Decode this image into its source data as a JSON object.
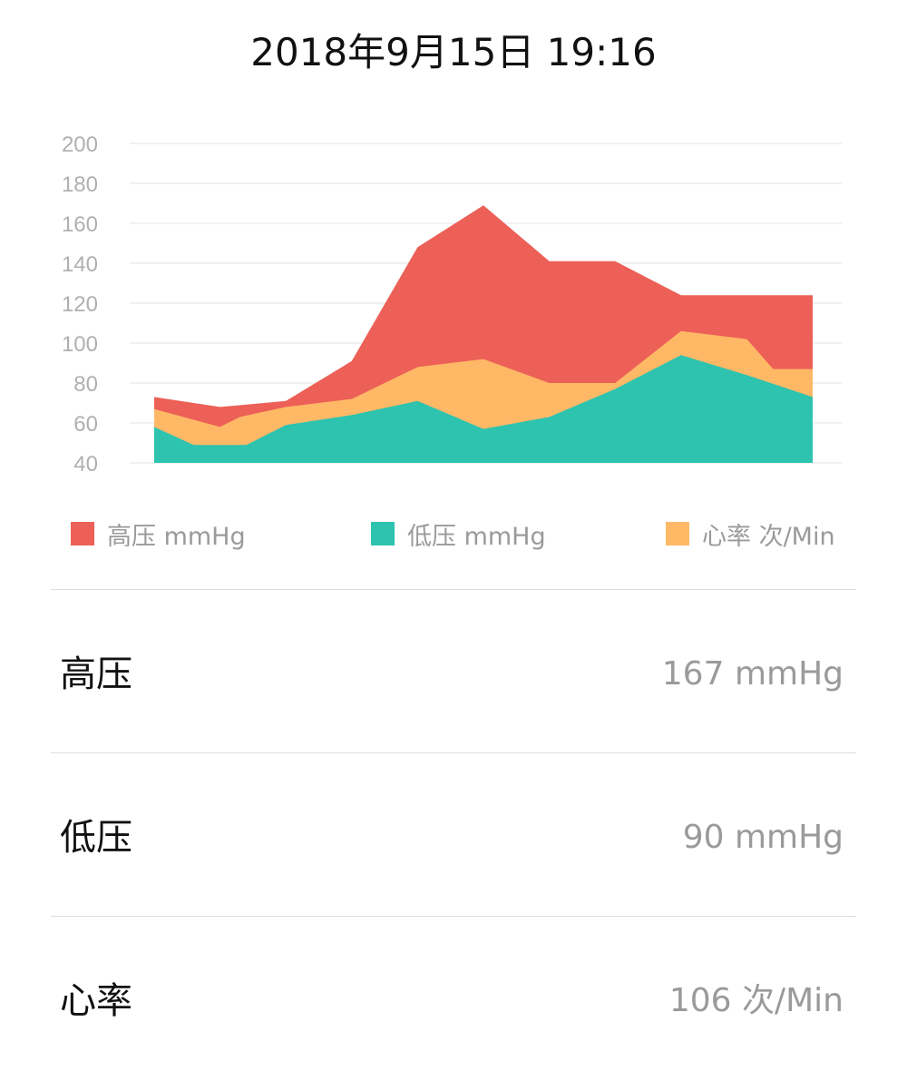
{
  "header": {
    "datetime": "2018年9月15日 19:16"
  },
  "chart_data": {
    "type": "area",
    "x": [
      1,
      2,
      3,
      4,
      5,
      6,
      7,
      8,
      9,
      10,
      11
    ],
    "ylim": [
      40,
      200
    ],
    "yticks": [
      "200",
      "180",
      "160",
      "140",
      "120",
      "100",
      "80",
      "60",
      "40"
    ],
    "grid": true,
    "legend_position": "bottom",
    "series": [
      {
        "name": "高压 mmHg",
        "color": "#ec6057",
        "values": [
          73,
          68,
          71,
          91,
          148,
          169,
          141,
          141,
          124,
          124,
          124
        ]
      },
      {
        "name": "心率 次/Min",
        "color": "#ffb866",
        "values": [
          67,
          58,
          68,
          72,
          88,
          92,
          80,
          80,
          106,
          102,
          87
        ]
      },
      {
        "name": "低压 mmHg",
        "color": "#2ec3af",
        "values": [
          58,
          49,
          49,
          59,
          71,
          57,
          63,
          77,
          94,
          84,
          73
        ]
      }
    ],
    "series_x": [
      [
        1,
        2,
        3,
        4,
        5,
        6,
        7,
        8,
        9,
        10,
        11
      ],
      [
        1,
        2,
        2.3,
        3,
        4,
        5,
        6,
        7,
        8,
        9,
        10,
        10.4,
        11
      ],
      [
        1,
        1.6,
        2,
        2.4,
        3,
        4,
        5,
        6,
        7,
        8,
        9,
        10,
        11
      ]
    ],
    "series_y": [
      [
        73,
        68,
        71,
        91,
        148,
        169,
        141,
        141,
        124,
        124,
        124
      ],
      [
        67,
        58,
        63,
        68,
        72,
        88,
        92,
        80,
        80,
        106,
        102,
        87,
        87
      ],
      [
        58,
        49,
        49,
        49,
        59,
        64,
        71,
        57,
        63,
        77,
        94,
        84,
        73
      ]
    ]
  },
  "legend": [
    {
      "label": "高压 mmHg",
      "color": "#ec6057"
    },
    {
      "label": "低压 mmHg",
      "color": "#2ec3af"
    },
    {
      "label": "心率 次/Min",
      "color": "#ffb866"
    }
  ],
  "stats": [
    {
      "label": "高压",
      "value": "167 mmHg"
    },
    {
      "label": "低压",
      "value": "90 mmHg"
    },
    {
      "label": "心率",
      "value": "106 次/Min"
    }
  ]
}
